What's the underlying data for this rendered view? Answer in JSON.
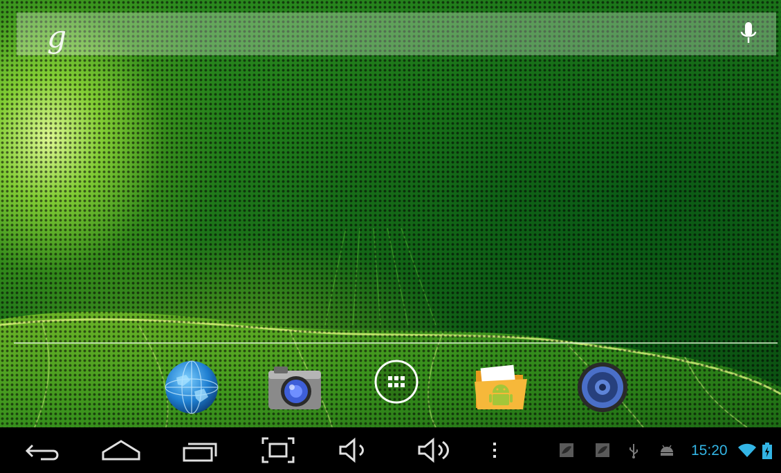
{
  "search": {
    "logo_text": "g",
    "mic_icon": "microphone-icon"
  },
  "dock": {
    "items": [
      {
        "name": "browser",
        "icon": "globe-icon"
      },
      {
        "name": "camera",
        "icon": "camera-icon"
      },
      {
        "name": "all-apps",
        "icon": "app-drawer-icon"
      },
      {
        "name": "file-manager",
        "icon": "android-folder-icon"
      },
      {
        "name": "music",
        "icon": "speaker-icon"
      }
    ]
  },
  "navbar": {
    "buttons": [
      {
        "name": "back",
        "icon": "back-arrow-icon"
      },
      {
        "name": "home",
        "icon": "home-icon"
      },
      {
        "name": "recent-apps",
        "icon": "recent-apps-icon"
      },
      {
        "name": "screenshot",
        "icon": "screenshot-icon"
      },
      {
        "name": "volume-down",
        "icon": "volume-down-icon"
      },
      {
        "name": "volume-up",
        "icon": "volume-up-icon"
      },
      {
        "name": "menu",
        "icon": "overflow-menu-icon"
      }
    ]
  },
  "status": {
    "time": "15:20",
    "icons": [
      "notification-image-icon",
      "notification-image-icon",
      "usb-icon",
      "android-debug-icon",
      "wifi-icon",
      "battery-charging-icon"
    ],
    "accent_color": "#33b5e5"
  }
}
